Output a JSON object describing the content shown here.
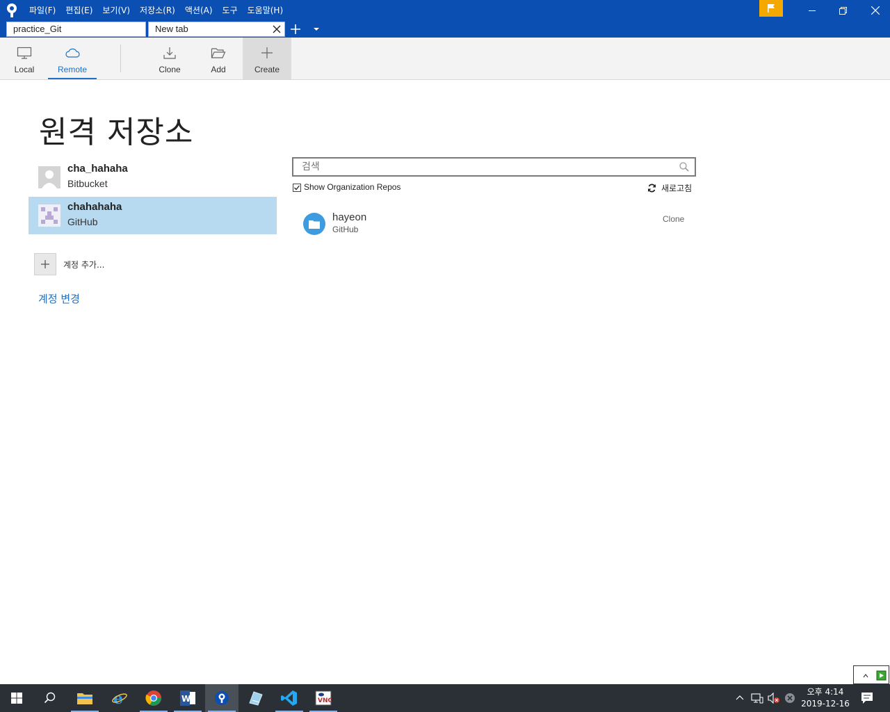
{
  "menu": [
    "파일(F)",
    "편집(E)",
    "보기(V)",
    "저장소(R)",
    "액션(A)",
    "도구",
    "도움말(H)"
  ],
  "tabs": [
    {
      "label": "practice_Git"
    },
    {
      "label": "New tab"
    }
  ],
  "toolbar": {
    "local": "Local",
    "remote": "Remote",
    "clone": "Clone",
    "add": "Add",
    "create": "Create"
  },
  "page": {
    "title": "원격 저장소"
  },
  "accounts": [
    {
      "name": "cha_hahaha",
      "host": "Bitbucket"
    },
    {
      "name": "chahahaha",
      "host": "GitHub"
    }
  ],
  "add_account": "계정 추가...",
  "change_account": "계정 변경",
  "search": {
    "placeholder": "검색"
  },
  "options": {
    "show_org_repos": "Show Organization Repos",
    "show_org_repos_checked": true,
    "refresh": "새로고침"
  },
  "repos": [
    {
      "name": "hayeon",
      "host": "GitHub",
      "action": "Clone"
    }
  ],
  "taskbar": {
    "time": "오후 4:14",
    "date": "2019-12-16"
  },
  "colors": {
    "titlebar": "#0b4fb3",
    "accent": "#1f6fc4",
    "selected_account": "#b8daf0",
    "flag": "#f5a800"
  }
}
